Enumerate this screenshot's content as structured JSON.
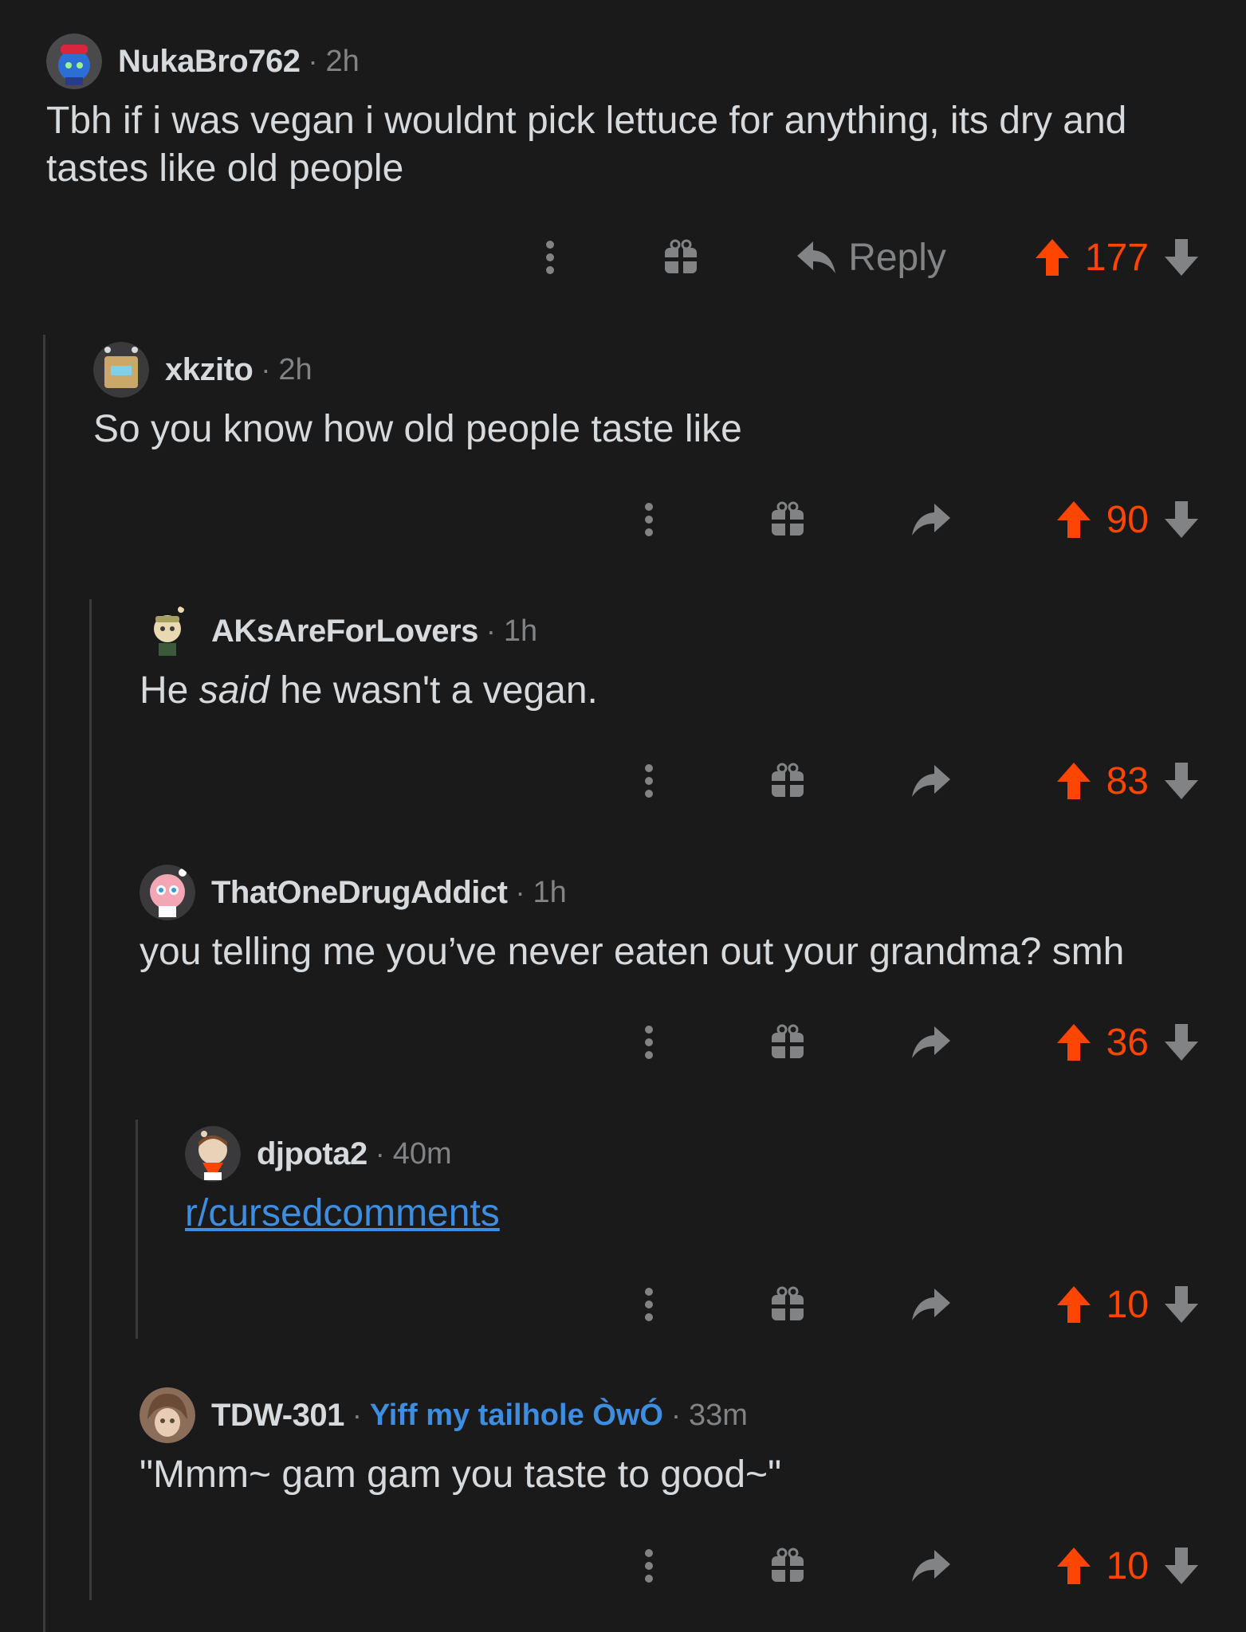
{
  "comments": [
    {
      "username": "NukaBro762",
      "time": "2h",
      "body": "Tbh if i was vegan i wouldnt pick lettuce for anything, its dry and tastes like old people",
      "reply_label": "Reply",
      "score": "177"
    },
    {
      "username": "xkzito",
      "time": "2h",
      "body": "So you know how old people taste like",
      "score": "90"
    },
    {
      "username": "AKsAreForLovers",
      "time": "1h",
      "body_pre": "He ",
      "body_em": "said",
      "body_post": " he wasn't a vegan.",
      "score": "83"
    },
    {
      "username": "ThatOneDrugAddict",
      "time": "1h",
      "body": "you telling me you’ve never eaten out your grandma? smh",
      "score": "36"
    },
    {
      "username": "djpota2",
      "time": "40m",
      "body": "r/cursedcomments",
      "score": "10"
    },
    {
      "username": "TDW-301",
      "flair": "Yiff my tailhole ÒwÓ",
      "time": "33m",
      "body": "\"Mmm~ gam gam you taste to good~\"",
      "score": "10"
    }
  ],
  "separator": "·",
  "colors": {
    "background": "#1a1a1b",
    "text": "#d7dadc",
    "muted": "#818384",
    "upvote": "#ff4500",
    "link": "#3d8de0",
    "thread_line": "#3a3a3c"
  },
  "icons": [
    "avatar",
    "more-options-icon",
    "gift-award-icon",
    "reply-arrow-icon",
    "upvote-arrow-icon",
    "downvote-arrow-icon"
  ]
}
